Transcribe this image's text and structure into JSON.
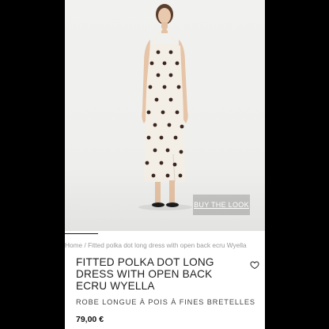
{
  "product": {
    "breadcrumb_home": "Home",
    "breadcrumb_sep": " / ",
    "breadcrumb_current": "Fitted polka dot long dress with open back ecru Wyella",
    "title": "FITTED POLKA DOT LONG DRESS WITH OPEN BACK ECRU WYELLA",
    "subtitle": "ROBE LONGUE À POIS À FINES BRETELLES",
    "price": "79,00 €",
    "buy_the_look_label": "BUY THE LOOK"
  },
  "icons": {
    "wishlist": "heart-icon"
  },
  "colors": {
    "dress": "#f4efe6",
    "dots": "#3a2620",
    "background": "#efefed"
  }
}
